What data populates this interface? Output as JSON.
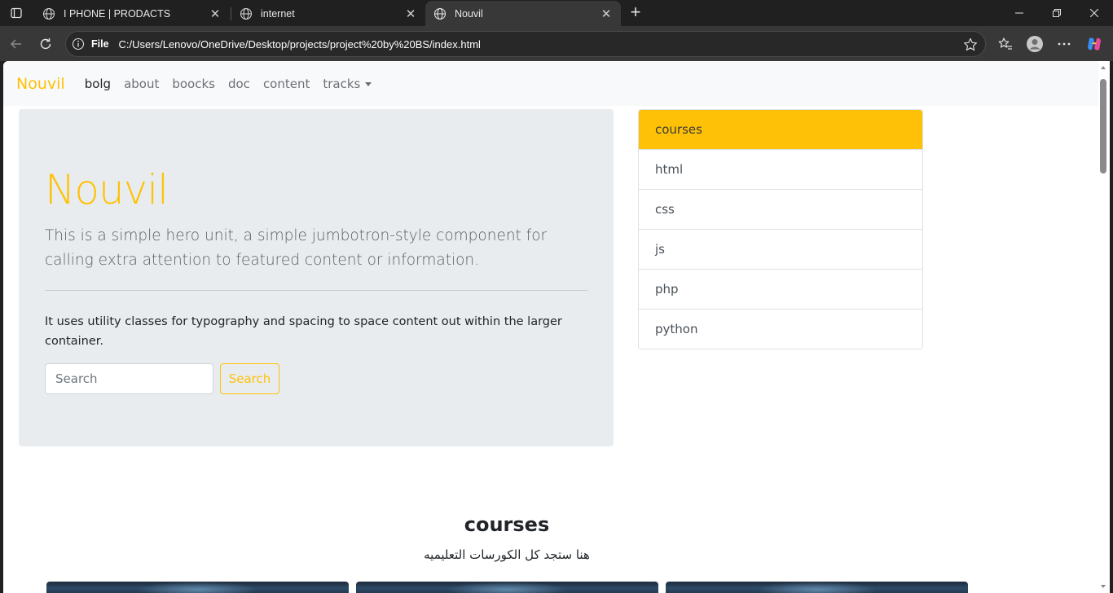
{
  "browser": {
    "tabs": [
      {
        "title": "I PHONE | PRODACTS"
      },
      {
        "title": "internet"
      },
      {
        "title": "Nouvil"
      }
    ],
    "address": {
      "scheme_label": "File",
      "url": "C:/Users/Lenovo/OneDrive/Desktop/projects/project%20by%20BS/index.html"
    }
  },
  "navbar": {
    "brand": "Nouvil",
    "links": [
      "bolg",
      "about",
      "boocks",
      "doc",
      "content"
    ],
    "dropdown_label": "tracks"
  },
  "hero": {
    "title": "Nouvil",
    "lead": "This is a simple hero unit, a simple jumbotron-style component for calling extra attention to featured content or information.",
    "body": "It uses utility classes for typography and spacing to space content out within the larger container.",
    "search_placeholder": "Search",
    "search_button": "Search"
  },
  "sidebar_list": {
    "items": [
      "courses",
      "html",
      "css",
      "js",
      "php",
      "python"
    ],
    "active_index": 0
  },
  "courses_section": {
    "title": "courses",
    "subtitle": "هنا ستجد كل الكورسات التعليميه"
  },
  "colors": {
    "accent": "#ffc107",
    "hero_bg": "#e9ecef",
    "navbar_bg": "#f8f9fa"
  }
}
